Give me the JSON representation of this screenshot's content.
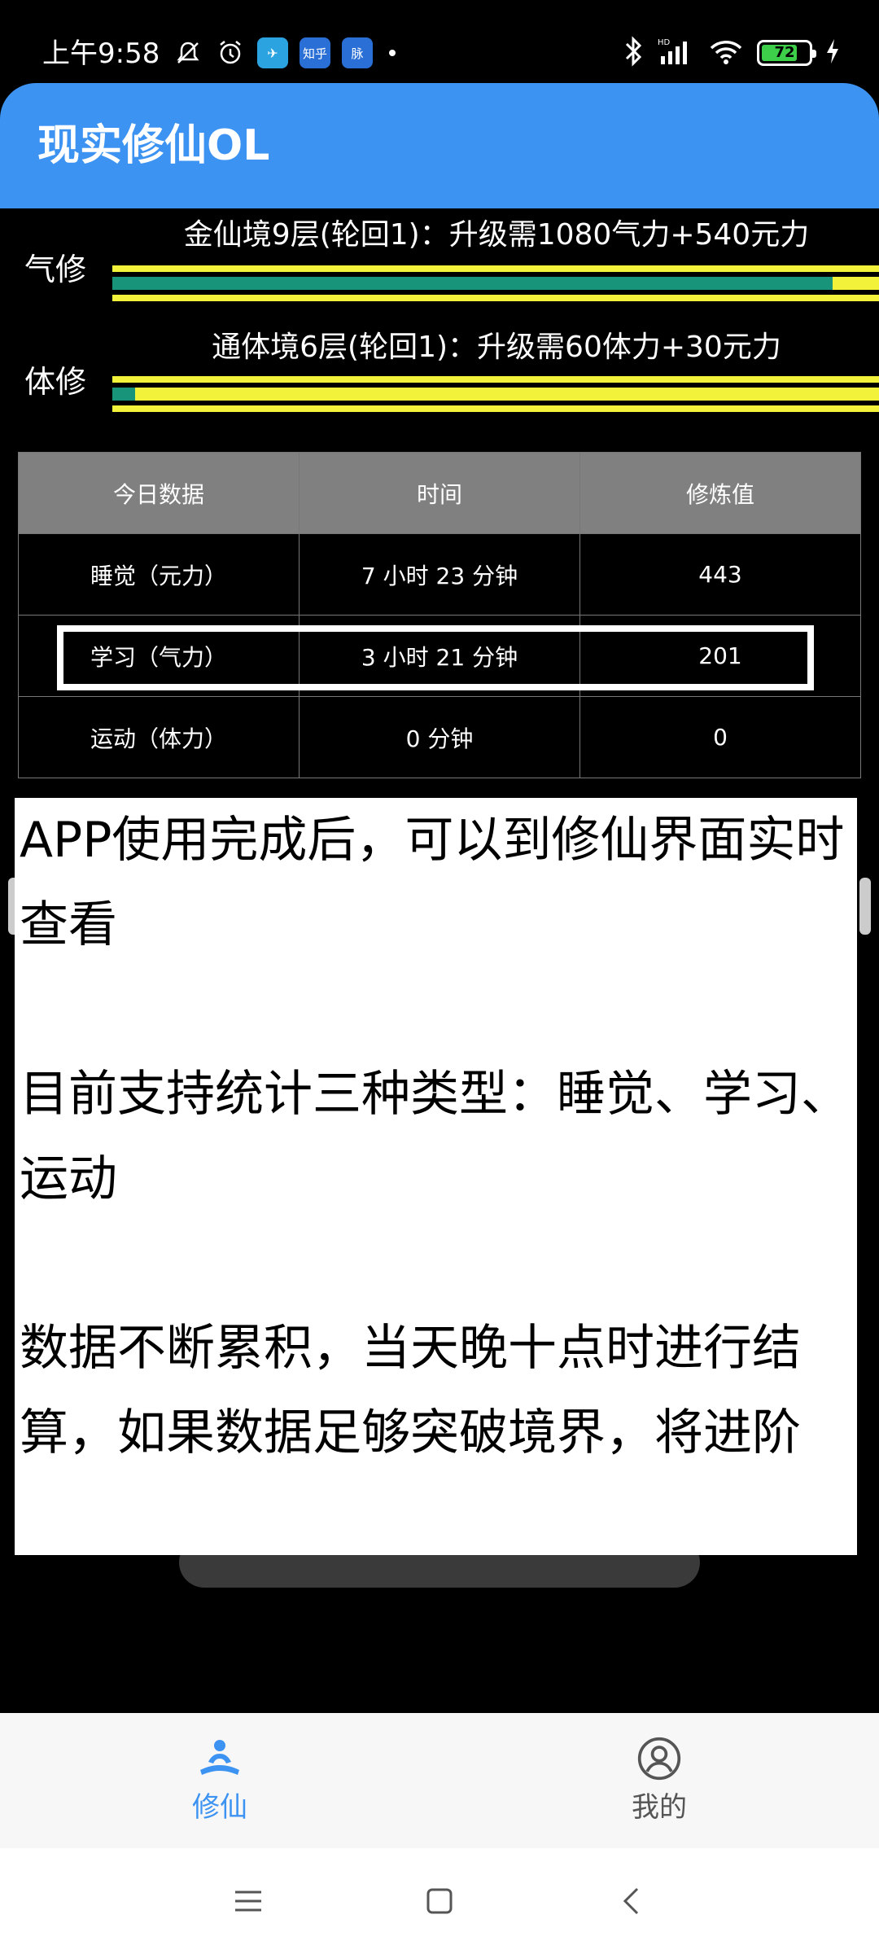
{
  "status_bar": {
    "time": "上午9:58",
    "app_icons": [
      {
        "name": "telegram",
        "glyph": "✈"
      },
      {
        "name": "zhihu",
        "label": "知乎"
      },
      {
        "name": "mai",
        "label": "脉"
      }
    ],
    "battery": "72"
  },
  "app": {
    "title": "现实修仙OL"
  },
  "cultivation": [
    {
      "name": "气修",
      "title": "金仙境9层(轮回1)：升级需1080气力+540元力",
      "progress": 0.94
    },
    {
      "name": "体修",
      "title": "通体境6层(轮回1)：升级需60体力+30元力",
      "progress": 0.03
    }
  ],
  "table": {
    "headers": [
      "今日数据",
      "时间",
      "修炼值"
    ],
    "rows": [
      [
        "睡觉（元力）",
        "7 小时 23 分钟",
        "443"
      ],
      [
        "学习（气力）",
        "3 小时 21 分钟",
        "201"
      ],
      [
        "运动（体力）",
        "0 分钟",
        "0"
      ]
    ]
  },
  "info_panel": {
    "paragraphs": [
      "APP使用完成后，可以到修仙界面实时查看",
      "目前支持统计三种类型：睡觉、学习、运动",
      "数据不断累积，当天晚十点时进行结算，如果数据足够突破境界，将进阶"
    ]
  },
  "bottom_nav": {
    "items": [
      {
        "label": "修仙",
        "active": true
      },
      {
        "label": "我的",
        "active": false
      }
    ]
  },
  "colors": {
    "accent": "#3d93f2",
    "bar_yellow": "#f2f23a",
    "bar_green": "#17947a"
  }
}
